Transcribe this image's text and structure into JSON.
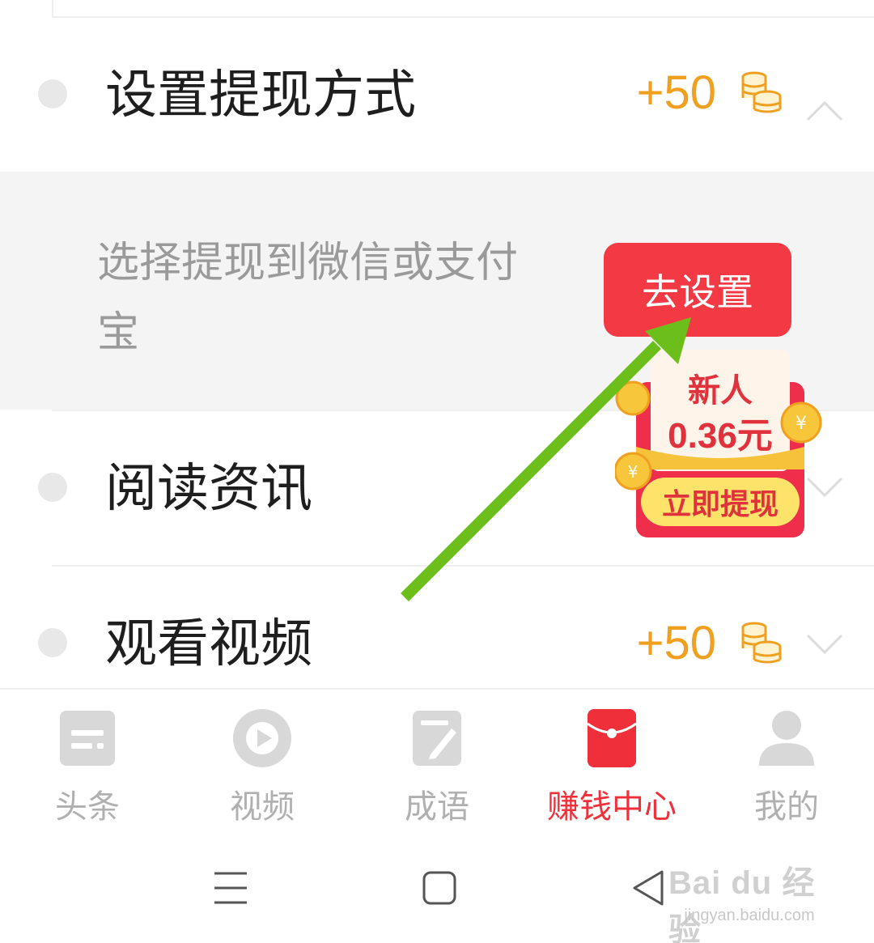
{
  "tasks": [
    {
      "title": "设置提现方式",
      "reward": "+50",
      "expanded": true
    },
    {
      "title": "阅读资讯"
    },
    {
      "title": "观看视频",
      "reward": "+50",
      "expanded": false
    }
  ],
  "detail": {
    "description": "选择提现到微信或支付宝",
    "action_label": "去设置"
  },
  "promo": {
    "heading": "新人",
    "amount": "0.36元",
    "button_label": "立即提现"
  },
  "tabs": [
    {
      "label": "头条",
      "icon": "headline-icon",
      "active": false
    },
    {
      "label": "视频",
      "icon": "play-icon",
      "active": false
    },
    {
      "label": "成语",
      "icon": "idiom-icon",
      "active": false
    },
    {
      "label": "赚钱中心",
      "icon": "red-envelope-icon",
      "active": true
    },
    {
      "label": "我的",
      "icon": "person-icon",
      "active": false
    }
  ],
  "system_nav": [
    "menu-icon",
    "home-icon",
    "back-icon"
  ],
  "watermark": {
    "logo": "Bai du 经验",
    "url": "jingyan.baidu.com"
  },
  "colors": {
    "accent": "#ef2f3a",
    "reward": "#f0a020",
    "arrow": "#6cbf1a"
  }
}
